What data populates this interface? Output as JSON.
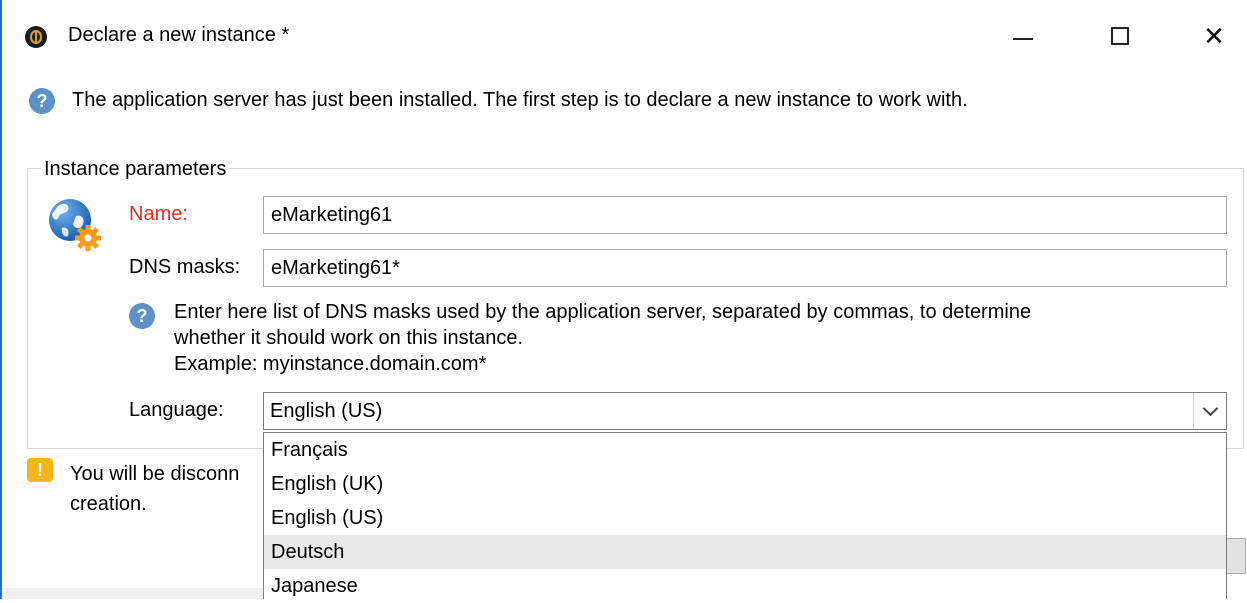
{
  "window": {
    "title": "Declare a new instance *",
    "controls": {
      "minimize": "minimize",
      "maximize": "maximize",
      "close": "✕"
    }
  },
  "intro": {
    "text": "The application server has just been installed. The first step is to declare a new instance to work with."
  },
  "instance_params": {
    "legend": "Instance parameters",
    "name_label": "Name:",
    "name_value": "eMarketing61",
    "dns_label": "DNS masks:",
    "dns_value": "eMarketing61*",
    "dns_help": {
      "line1": "Enter here list of DNS masks used by the application server, separated by commas, to determine",
      "line2": "whether it should work on this instance.",
      "line3": "Example: myinstance.domain.com*"
    },
    "language_label": "Language:",
    "language_value": "English (US)",
    "language_options": [
      "Français",
      "English (UK)",
      "English (US)",
      "Deutsch",
      "Japanese"
    ],
    "hovered_option": "Deutsch"
  },
  "warning": {
    "line1": "You will be disconn",
    "line2": "creation."
  },
  "icons": {
    "app": "app-logo-icon",
    "help": "question-icon",
    "globe": "globe-gear-icon",
    "warning": "exclamation-icon",
    "dropdown": "chevron-down-icon"
  },
  "colors": {
    "accent": "#1a73c8",
    "required_label": "#e0302a",
    "help": "#5d92c6",
    "warning": "#f3b61b",
    "hover": "#e8e8e8"
  }
}
